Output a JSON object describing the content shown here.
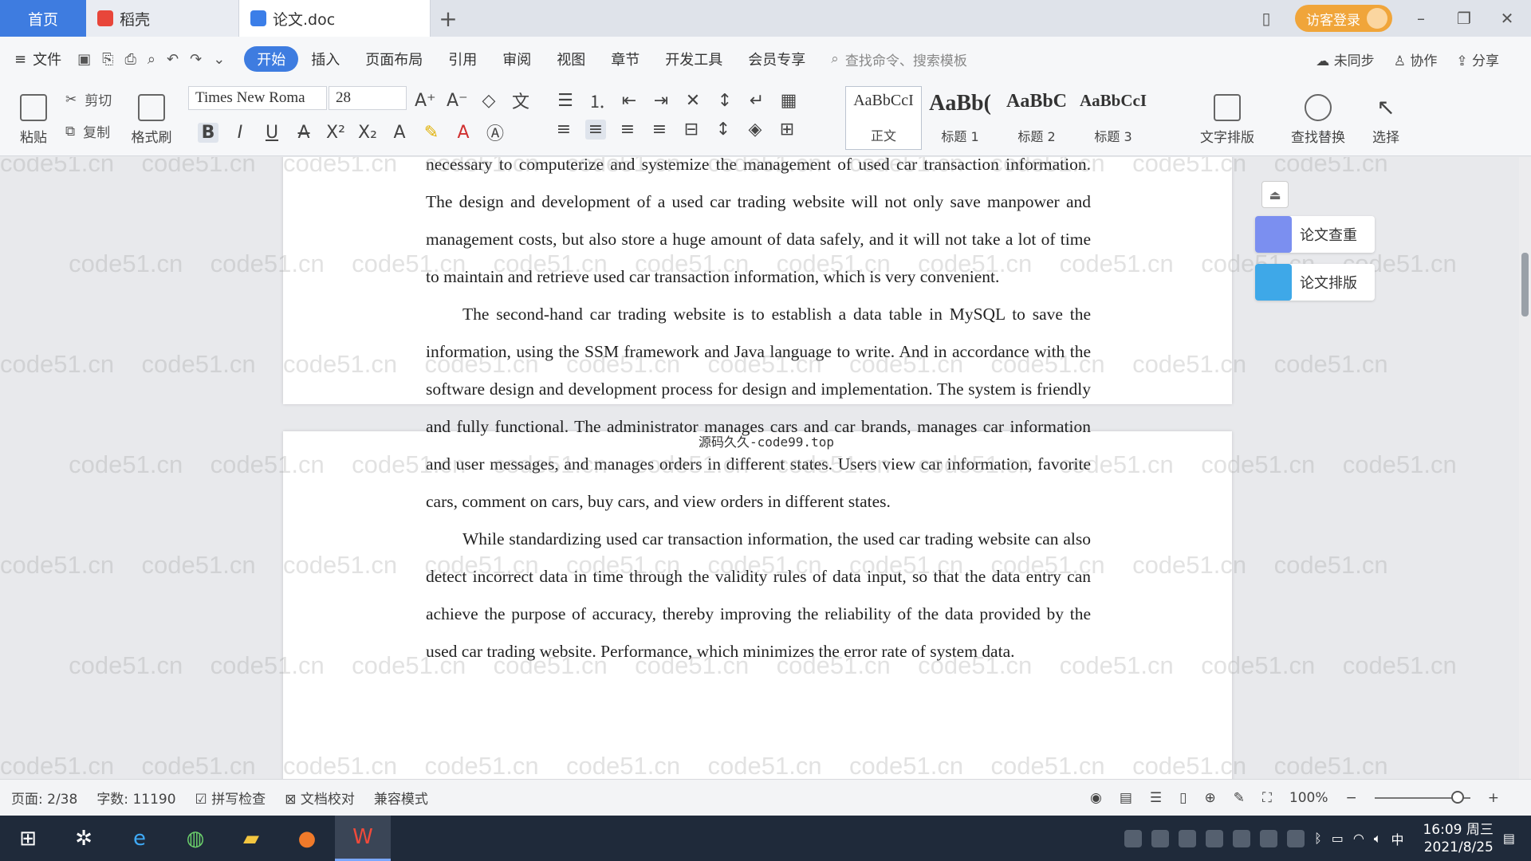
{
  "tabs": {
    "home": "首页",
    "docer": "稻壳",
    "doc": "论文.doc",
    "login": "访客登录"
  },
  "menu": {
    "file": "文件",
    "items": [
      "开始",
      "插入",
      "页面布局",
      "引用",
      "审阅",
      "视图",
      "章节",
      "开发工具",
      "会员专享"
    ],
    "search_placeholder": "查找命令、搜索模板",
    "sync": "未同步",
    "collab": "协作",
    "share": "分享"
  },
  "ribbon": {
    "paste": "粘贴",
    "cut": "剪切",
    "copy": "复制",
    "format_painter": "格式刷",
    "font_name": "Times New Roma",
    "font_size": "28",
    "styles": [
      {
        "preview": "AaBbCcI",
        "name": "正文"
      },
      {
        "preview": "AaBb(",
        "name": "标题 1"
      },
      {
        "preview": "AaBbC",
        "name": "标题 2"
      },
      {
        "preview": "AaBbCcI",
        "name": "标题 3"
      }
    ],
    "text_layout": "文字排版",
    "find_replace": "查找替换",
    "select": "选择"
  },
  "document": {
    "paragraphs": [
      {
        "indent": false,
        "text": "necessary to computerize and systemize the management of used car transaction information. The design and development of a used car trading website will not only save manpower and management costs, but also store a huge amount of data safely, and it will not take a lot of time to maintain and retrieve used car transaction information, which is very convenient."
      },
      {
        "indent": true,
        "text": "The second-hand car trading website is to establish a data table in MySQL to save the information, using the SSM framework and Java language to write. And in accordance with the software design and development process for design and implementation. The system is friendly and fully functional. The administrator manages cars and car brands, manages car information and user messages, and manages orders in different states. Users view car information, favorite cars, comment on cars, buy cars, and view orders in different states."
      },
      {
        "indent": true,
        "text": "While standardizing used car transaction information, the used car trading website can also detect incorrect data in time through the validity rules of data input, so that the data entry can achieve the purpose of accuracy, thereby improving the reliability of the data provided by the used car trading website. Performance, which minimizes the error rate of system data."
      }
    ],
    "center_mark": "源码久久-code99.top",
    "watermark": "code51.cn"
  },
  "side_panel": {
    "check": "论文查重",
    "layout": "论文排版"
  },
  "status": {
    "page": "页面: 2/38",
    "words": "字数: 11190",
    "spell": "拼写检查",
    "proof": "文档校对",
    "compat": "兼容模式",
    "zoom": "100%"
  },
  "taskbar": {
    "time": "16:09 周三",
    "date": "2021/8/25",
    "ime": "中"
  }
}
